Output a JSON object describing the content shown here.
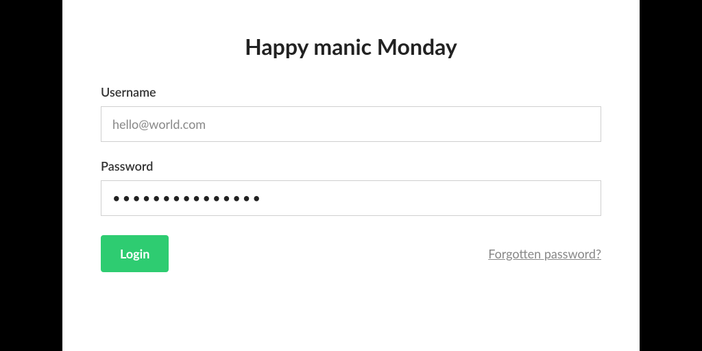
{
  "title": "Happy manic Monday",
  "form": {
    "username": {
      "label": "Username",
      "value": "hello@world.com"
    },
    "password": {
      "label": "Password",
      "value": "•••••••••••••••"
    },
    "login_button": "Login",
    "forgot_link": "Forgotten password?"
  },
  "colors": {
    "accent": "#2ecc71"
  }
}
